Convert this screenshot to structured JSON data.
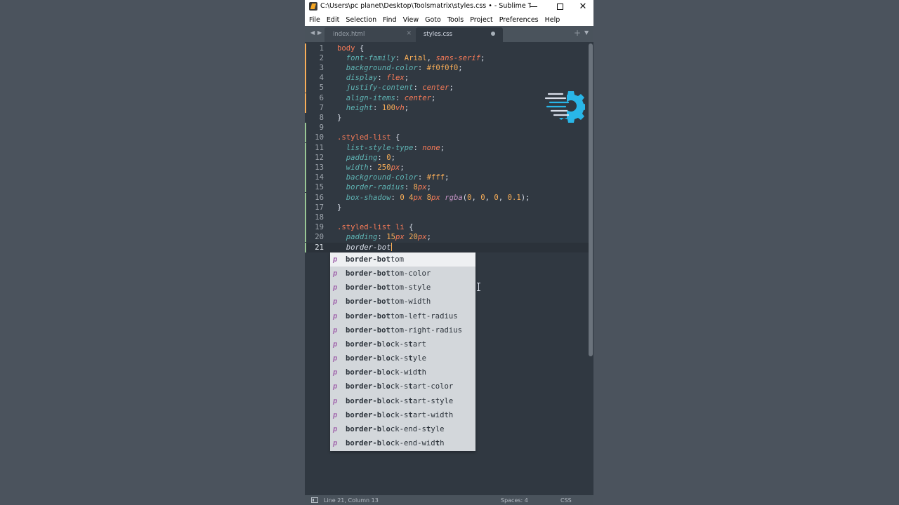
{
  "window": {
    "title": "C:\\Users\\pc planet\\Desktop\\Toolsmatrix\\styles.css • - Sublime Text (UN...",
    "close_glyph": "✕"
  },
  "menu": [
    "File",
    "Edit",
    "Selection",
    "Find",
    "View",
    "Goto",
    "Tools",
    "Project",
    "Preferences",
    "Help"
  ],
  "tabs": [
    {
      "label": "index.html",
      "active": false,
      "close_glyph": "✕"
    },
    {
      "label": "styles.css",
      "active": true,
      "modified": true
    }
  ],
  "tabbar": {
    "prev_glyph": "◀",
    "next_glyph": "▶",
    "new_glyph": "+",
    "list_glyph": "▼"
  },
  "editor": {
    "line_numbers": [
      "1",
      "2",
      "3",
      "4",
      "5",
      "6",
      "7",
      "8",
      "9",
      "10",
      "11",
      "12",
      "13",
      "14",
      "15",
      "16",
      "17",
      "18",
      "19",
      "20",
      "21"
    ],
    "active_line": 21,
    "lines": [
      "body {",
      "  font-family: Arial, sans-serif;",
      "  background-color: #f0f0f0;",
      "  display: flex;",
      "  justify-content: center;",
      "  align-items: center;",
      "  height: 100vh;",
      "}",
      "",
      ".styled-list {",
      "  list-style-type: none;",
      "  padding: 0;",
      "  width: 250px;",
      "  background-color: #fff;",
      "  border-radius: 8px;",
      "  box-shadow: 0 4px 8px rgba(0, 0, 0, 0.1);",
      "}",
      "",
      ".styled-list li {",
      "  padding: 15px 20px;",
      "  border-bot"
    ]
  },
  "autocomplete": {
    "kind_glyph": "p",
    "items": [
      "border-bottom",
      "border-bottom-color",
      "border-bottom-style",
      "border-bottom-width",
      "border-bottom-left-radius",
      "border-bottom-right-radius",
      "border-block-start",
      "border-block-style",
      "border-block-width",
      "border-block-start-color",
      "border-block-start-style",
      "border-block-start-width",
      "border-block-end-style",
      "border-block-end-width"
    ],
    "selected_index": 0
  },
  "status": {
    "position": "Line 21, Column 13",
    "indent": "Spaces: 4",
    "syntax": "CSS"
  },
  "colors": {
    "editor_bg": "#303841",
    "selector": "#f97b58",
    "property": "#5fb4b4",
    "value": "#f9ae58",
    "function": "#c695c6",
    "logo_accent": "#29b6e8"
  },
  "icons": [
    "app-icon",
    "gear-logo-icon",
    "panel-toggle-icon",
    "ibeam-cursor-icon"
  ]
}
